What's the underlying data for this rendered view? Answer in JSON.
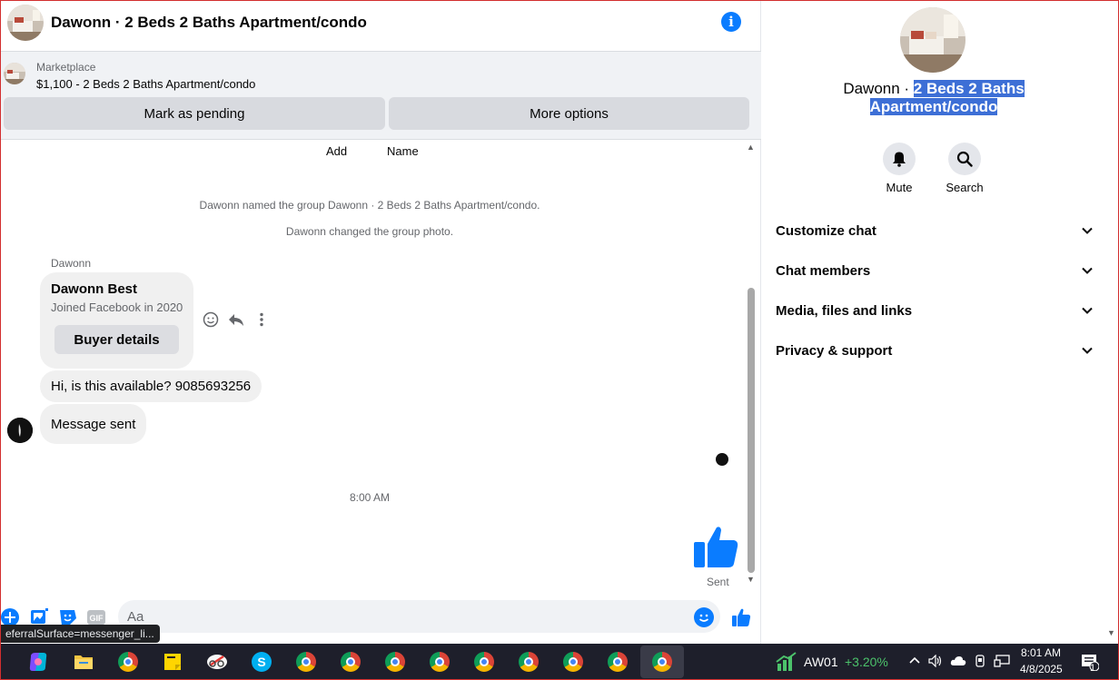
{
  "header": {
    "title": "Dawonn · 2 Beds 2 Baths Apartment/condo",
    "info_glyph": "i"
  },
  "marketplace": {
    "label": "Marketplace",
    "listing": "$1,100 - 2 Beds 2 Baths Apartment/condo",
    "pending_button": "Mark as pending",
    "more_button": "More options"
  },
  "thread": {
    "add_label": "Add",
    "name_label": "Name",
    "system_messages": [
      "Dawonn named the group Dawonn · 2 Beds 2 Baths Apartment/condo.",
      "Dawonn changed the group photo."
    ],
    "sender": "Dawonn",
    "profile_card": {
      "name": "Dawonn Best",
      "subtitle": "Joined Facebook in 2020",
      "button": "Buyer details"
    },
    "messages": [
      "Hi, is this available? 9085693256",
      "Message sent"
    ],
    "timestamp": "8:00 AM",
    "sent_status": "Sent"
  },
  "composer": {
    "placeholder": "Aa",
    "gif_label": "GIF"
  },
  "status_bar_url": "eferralSurface=messenger_li...",
  "sidebar": {
    "title_plain": "Dawonn · ",
    "title_highlight_1": "2 Beds 2 Baths",
    "title_highlight_2": "Apartment/condo",
    "actions": [
      {
        "label": "Mute",
        "icon": "bell-icon"
      },
      {
        "label": "Search",
        "icon": "search-icon"
      }
    ],
    "menu": [
      "Customize chat",
      "Chat members",
      "Media, files and links",
      "Privacy & support"
    ]
  },
  "taskbar": {
    "stock_symbol": "AW01",
    "stock_change": "+3.20%",
    "time": "8:01 AM",
    "date": "4/8/2025",
    "notification_count": "1"
  },
  "colors": {
    "accent": "#0a7cff",
    "highlight": "#3d6fd6",
    "stock_positive": "#4cc26b",
    "taskbar_bg": "#1e1f2b"
  }
}
